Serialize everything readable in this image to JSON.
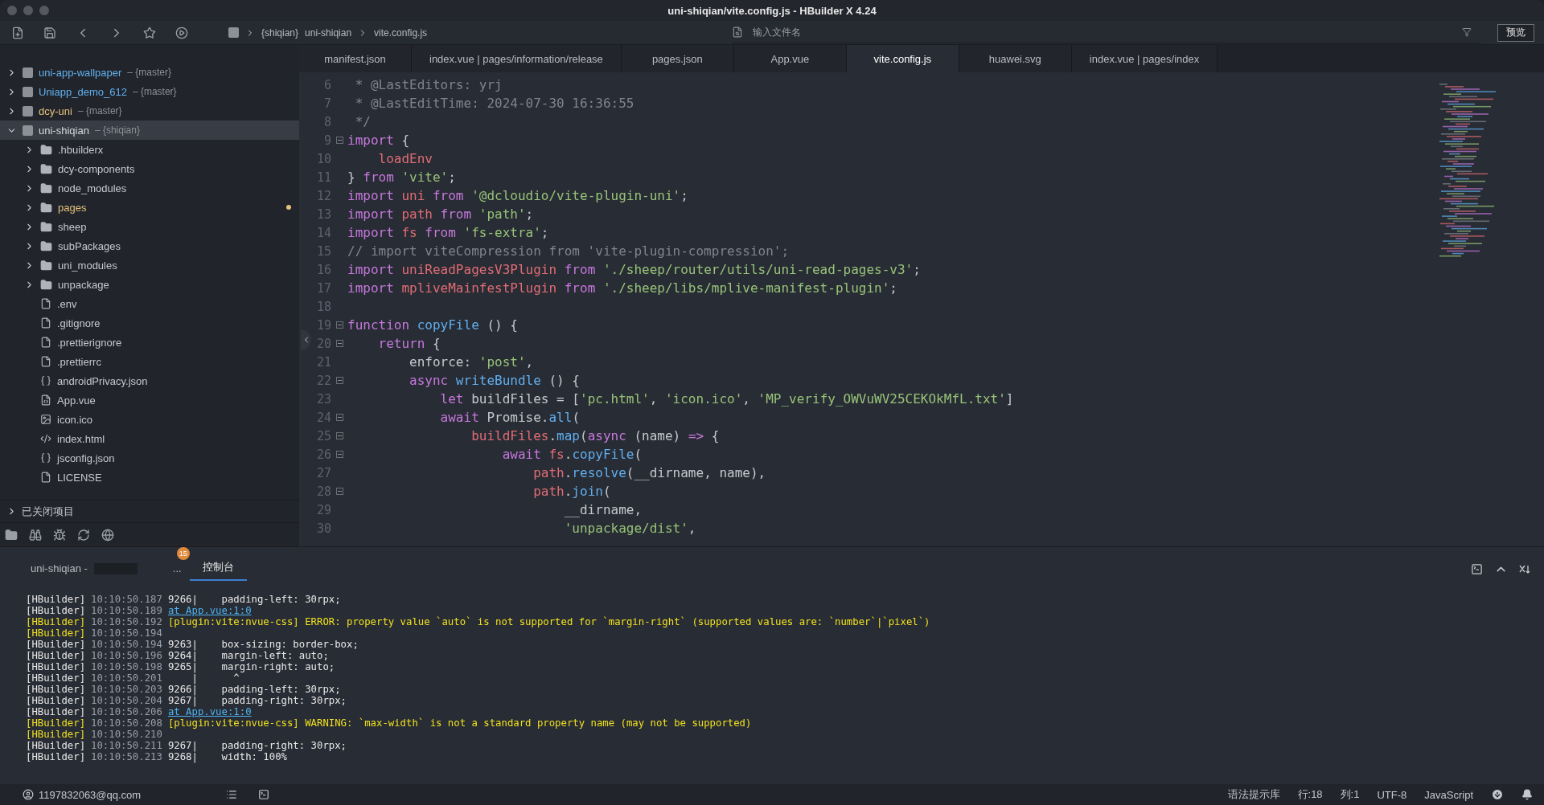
{
  "window": {
    "title": "uni-shiqian/vite.config.js - HBuilder X 4.24"
  },
  "toolbar": {
    "breadcrumb": {
      "branch": "{shiqian}",
      "segments": [
        "uni-shiqian",
        "vite.config.js"
      ]
    },
    "search": {
      "placeholder": "输入文件名"
    },
    "preview_button": "预览"
  },
  "sidebar": {
    "projects": [
      {
        "name": "uni-app-wallpaper",
        "branch": "– {master}",
        "color": "#61afef",
        "expanded": false,
        "selected": false
      },
      {
        "name": "Uniapp_demo_612",
        "branch": "– {master}",
        "color": "#61afef",
        "expanded": false,
        "selected": false
      },
      {
        "name": "dcy-uni",
        "branch": "– {master}",
        "color": "#e5c07b",
        "expanded": false,
        "selected": false
      },
      {
        "name": "uni-shiqian",
        "branch": "– {shiqian}",
        "color": "#d7dae0",
        "expanded": true,
        "selected": true,
        "children": [
          {
            "name": ".hbuilderx",
            "kind": "folder",
            "expanded": false,
            "modified": false,
            "selected": false
          },
          {
            "name": "dcy-components",
            "kind": "folder",
            "expanded": false,
            "modified": false,
            "selected": false
          },
          {
            "name": "node_modules",
            "kind": "folder",
            "expanded": false,
            "modified": false,
            "selected": false
          },
          {
            "name": "pages",
            "kind": "folder",
            "expanded": false,
            "modified": true,
            "selected": false
          },
          {
            "name": "sheep",
            "kind": "folder",
            "expanded": false,
            "modified": false,
            "selected": false
          },
          {
            "name": "subPackages",
            "kind": "folder",
            "expanded": false,
            "modified": false,
            "selected": false
          },
          {
            "name": "uni_modules",
            "kind": "folder",
            "expanded": false,
            "modified": false,
            "selected": false
          },
          {
            "name": "unpackage",
            "kind": "folder",
            "expanded": false,
            "modified": false,
            "selected": false
          },
          {
            "name": ".env",
            "kind": "file",
            "modified": false,
            "selected": false
          },
          {
            "name": ".gitignore",
            "kind": "file",
            "modified": false,
            "selected": false
          },
          {
            "name": ".prettierignore",
            "kind": "file",
            "modified": false,
            "selected": false
          },
          {
            "name": ".prettierrc",
            "kind": "file",
            "modified": false,
            "selected": false
          },
          {
            "name": "androidPrivacy.json",
            "kind": "json",
            "modified": false,
            "selected": false
          },
          {
            "name": "App.vue",
            "kind": "vue",
            "modified": false,
            "selected": false
          },
          {
            "name": "icon.ico",
            "kind": "image",
            "modified": false,
            "selected": false
          },
          {
            "name": "index.html",
            "kind": "html",
            "modified": false,
            "selected": false
          },
          {
            "name": "jsconfig.json",
            "kind": "json",
            "modified": false,
            "selected": false
          },
          {
            "name": "LICENSE",
            "kind": "file",
            "modified": false,
            "selected": false
          }
        ]
      }
    ],
    "closed_projects": {
      "label": "已关闭项目",
      "expanded": false
    }
  },
  "editor_tabs": [
    {
      "label": "manifest.json",
      "selected": false
    },
    {
      "label": "index.vue | pages/information/release",
      "selected": false
    },
    {
      "label": "pages.json",
      "selected": false
    },
    {
      "label": "App.vue",
      "selected": false
    },
    {
      "label": "vite.config.js",
      "selected": true
    },
    {
      "label": "huawei.svg",
      "selected": false
    },
    {
      "label": "index.vue | pages/index",
      "selected": false
    }
  ],
  "code_lines": [
    {
      "number": "6",
      "fold": false,
      "tokens": [
        {
          "kind": "comment",
          "text": " * @LastEditors: yrj"
        }
      ]
    },
    {
      "number": "7",
      "fold": false,
      "tokens": [
        {
          "kind": "comment",
          "text": " * @LastEditTime: 2024-07-30 16:36:55"
        }
      ]
    },
    {
      "number": "8",
      "fold": false,
      "tokens": [
        {
          "kind": "comment",
          "text": " */"
        }
      ]
    },
    {
      "number": "9",
      "fold": true,
      "tokens": [
        {
          "kind": "keyword",
          "text": "import"
        },
        {
          "kind": "plain",
          "text": " {"
        }
      ]
    },
    {
      "number": "10",
      "fold": false,
      "tokens": [
        {
          "kind": "variable",
          "text": "    loadEnv"
        }
      ]
    },
    {
      "number": "11",
      "fold": false,
      "tokens": [
        {
          "kind": "plain",
          "text": "} "
        },
        {
          "kind": "keyword",
          "text": "from"
        },
        {
          "kind": "string",
          "text": " 'vite'"
        },
        {
          "kind": "plain",
          "text": ";"
        }
      ]
    },
    {
      "number": "12",
      "fold": false,
      "tokens": [
        {
          "kind": "keyword",
          "text": "import"
        },
        {
          "kind": "variable",
          "text": " uni"
        },
        {
          "kind": "keyword",
          "text": " from"
        },
        {
          "kind": "string",
          "text": " '@dcloudio/vite-plugin-uni'"
        },
        {
          "kind": "plain",
          "text": ";"
        }
      ]
    },
    {
      "number": "13",
      "fold": false,
      "tokens": [
        {
          "kind": "keyword",
          "text": "import"
        },
        {
          "kind": "variable",
          "text": " path"
        },
        {
          "kind": "keyword",
          "text": " from"
        },
        {
          "kind": "string",
          "text": " 'path'"
        },
        {
          "kind": "plain",
          "text": ";"
        }
      ]
    },
    {
      "number": "14",
      "fold": false,
      "tokens": [
        {
          "kind": "keyword",
          "text": "import"
        },
        {
          "kind": "variable",
          "text": " fs"
        },
        {
          "kind": "keyword",
          "text": " from"
        },
        {
          "kind": "string",
          "text": " 'fs-extra'"
        },
        {
          "kind": "plain",
          "text": ";"
        }
      ]
    },
    {
      "number": "15",
      "fold": false,
      "tokens": [
        {
          "kind": "comment",
          "text": "// import viteCompression from 'vite-plugin-compression';"
        }
      ]
    },
    {
      "number": "16",
      "fold": false,
      "tokens": [
        {
          "kind": "keyword",
          "text": "import"
        },
        {
          "kind": "variable",
          "text": " uniReadPagesV3Plugin"
        },
        {
          "kind": "keyword",
          "text": " from"
        },
        {
          "kind": "string",
          "text": " './sheep/router/utils/uni-read-pages-v3'"
        },
        {
          "kind": "plain",
          "text": ";"
        }
      ]
    },
    {
      "number": "17",
      "fold": false,
      "tokens": [
        {
          "kind": "keyword",
          "text": "import"
        },
        {
          "kind": "variable",
          "text": " mpliveMainfestPlugin"
        },
        {
          "kind": "keyword",
          "text": " from"
        },
        {
          "kind": "string",
          "text": " './sheep/libs/mplive-manifest-plugin'"
        },
        {
          "kind": "plain",
          "text": ";"
        }
      ]
    },
    {
      "number": "18",
      "fold": false
    },
    {
      "number": "19",
      "fold": true,
      "tokens": [
        {
          "kind": "keyword",
          "text": "function"
        },
        {
          "kind": "function",
          "text": " copyFile"
        },
        {
          "kind": "plain",
          "text": " () {"
        }
      ]
    },
    {
      "number": "20",
      "fold": true,
      "tokens": [
        {
          "kind": "keyword",
          "text": "    return"
        },
        {
          "kind": "plain",
          "text": " {"
        }
      ]
    },
    {
      "number": "21",
      "fold": false,
      "tokens": [
        {
          "kind": "plain",
          "text": "        enforce: "
        },
        {
          "kind": "string",
          "text": "'post'"
        },
        {
          "kind": "plain",
          "text": ","
        }
      ]
    },
    {
      "number": "22",
      "fold": true,
      "tokens": [
        {
          "kind": "keyword",
          "text": "        async"
        },
        {
          "kind": "function",
          "text": " writeBundle"
        },
        {
          "kind": "plain",
          "text": " () {"
        }
      ]
    },
    {
      "number": "23",
      "fold": false,
      "tokens": [
        {
          "kind": "keyword",
          "text": "            let"
        },
        {
          "kind": "plain",
          "text": " buildFiles = ["
        },
        {
          "kind": "string",
          "text": "'pc.html'"
        },
        {
          "kind": "plain",
          "text": ", "
        },
        {
          "kind": "string",
          "text": "'icon.ico'"
        },
        {
          "kind": "plain",
          "text": ", "
        },
        {
          "kind": "string",
          "text": "'MP_verify_OWVuWV25CEKOkMfL.txt'"
        },
        {
          "kind": "plain",
          "text": "]"
        }
      ]
    },
    {
      "number": "24",
      "fold": true,
      "tokens": [
        {
          "kind": "keyword",
          "text": "            await"
        },
        {
          "kind": "plain",
          "text": " Promise."
        },
        {
          "kind": "function",
          "text": "all"
        },
        {
          "kind": "plain",
          "text": "("
        }
      ]
    },
    {
      "number": "25",
      "fold": true,
      "tokens": [
        {
          "kind": "variable",
          "text": "                buildFiles"
        },
        {
          "kind": "plain",
          "text": "."
        },
        {
          "kind": "function",
          "text": "map"
        },
        {
          "kind": "plain",
          "text": "("
        },
        {
          "kind": "keyword",
          "text": "async"
        },
        {
          "kind": "plain",
          "text": " (name) "
        },
        {
          "kind": "keyword",
          "text": "=>"
        },
        {
          "kind": "plain",
          "text": " {"
        }
      ]
    },
    {
      "number": "26",
      "fold": true,
      "tokens": [
        {
          "kind": "keyword",
          "text": "                    await"
        },
        {
          "kind": "variable",
          "text": " fs"
        },
        {
          "kind": "plain",
          "text": "."
        },
        {
          "kind": "function",
          "text": "copyFile"
        },
        {
          "kind": "plain",
          "text": "("
        }
      ]
    },
    {
      "number": "27",
      "fold": false,
      "tokens": [
        {
          "kind": "variable",
          "text": "                        path"
        },
        {
          "kind": "plain",
          "text": "."
        },
        {
          "kind": "function",
          "text": "resolve"
        },
        {
          "kind": "plain",
          "text": "(__dirname, name),"
        }
      ]
    },
    {
      "number": "28",
      "fold": true,
      "tokens": [
        {
          "kind": "variable",
          "text": "                        path"
        },
        {
          "kind": "plain",
          "text": "."
        },
        {
          "kind": "function",
          "text": "join"
        },
        {
          "kind": "plain",
          "text": "("
        }
      ]
    },
    {
      "number": "29",
      "fold": false,
      "tokens": [
        {
          "kind": "plain",
          "text": "                            __dirname,"
        }
      ]
    },
    {
      "number": "30",
      "fold": false,
      "tokens": [
        {
          "kind": "string",
          "text": "                            'unpackage/dist'"
        },
        {
          "kind": "plain",
          "text": ","
        }
      ]
    }
  ],
  "console": {
    "tabs": [
      {
        "label": "uni-shiqian -",
        "redacted": true,
        "selected": false
      },
      {
        "label": "...",
        "badge": "15",
        "redacted": false,
        "selected": false
      },
      {
        "label": "控制台",
        "redacted": false,
        "selected": true
      }
    ],
    "lines": [
      {
        "source": "[HBuilder]",
        "time": "10:10:50.187",
        "kind": "info",
        "message": "9266|    padding-left: 30rpx;"
      },
      {
        "source": "[HBuilder]",
        "time": "10:10:50.189",
        "kind": "link",
        "message": "at App.vue:1:0"
      },
      {
        "source": "[HBuilder]",
        "time": "10:10:50.192",
        "kind": "warn",
        "message": "[plugin:vite:nvue-css] ERROR: property value `auto` is not supported for `margin-right` (supported values are: `number`|`pixel`)"
      },
      {
        "source": "[HBuilder]",
        "time": "10:10:50.194",
        "kind": "warn"
      },
      {
        "source": "[HBuilder]",
        "time": "10:10:50.194",
        "kind": "info",
        "message": "9263|    box-sizing: border-box;"
      },
      {
        "source": "[HBuilder]",
        "time": "10:10:50.196",
        "kind": "info",
        "message": "9264|    margin-left: auto;"
      },
      {
        "source": "[HBuilder]",
        "time": "10:10:50.198",
        "kind": "info",
        "message": "9265|    margin-right: auto;"
      },
      {
        "source": "[HBuilder]",
        "time": "10:10:50.201",
        "kind": "info",
        "message": "    |      ^"
      },
      {
        "source": "[HBuilder]",
        "time": "10:10:50.203",
        "kind": "info",
        "message": "9266|    padding-left: 30rpx;"
      },
      {
        "source": "[HBuilder]",
        "time": "10:10:50.204",
        "kind": "info",
        "message": "9267|    padding-right: 30rpx;"
      },
      {
        "source": "[HBuilder]",
        "time": "10:10:50.206",
        "kind": "link",
        "message": "at App.vue:1:0"
      },
      {
        "source": "[HBuilder]",
        "time": "10:10:50.208",
        "kind": "warn",
        "message": "[plugin:vite:nvue-css] WARNING: `max-width` is not a standard property name (may not be supported)"
      },
      {
        "source": "[HBuilder]",
        "time": "10:10:50.210",
        "kind": "warn"
      },
      {
        "source": "[HBuilder]",
        "time": "10:10:50.211",
        "kind": "info",
        "message": "9267|    padding-right: 30rpx;"
      },
      {
        "source": "[HBuilder]",
        "time": "10:10:50.213",
        "kind": "info",
        "message": "9268|    width: 100%"
      }
    ]
  },
  "status_bar": {
    "account": "1197832063@qq.com",
    "items": [
      "语法提示库",
      "行:18",
      "列:1",
      "UTF-8",
      "JavaScript"
    ]
  }
}
